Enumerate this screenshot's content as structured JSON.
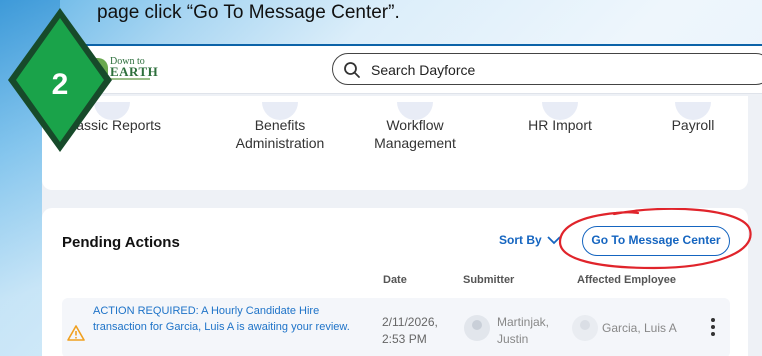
{
  "instruction": {
    "text": "page click “Go To Message Center”."
  },
  "step_badge": {
    "number": "2",
    "fill_color": "#1aa34a",
    "border_color": "#174a2a"
  },
  "header": {
    "logo_line1": "Down to",
    "logo_line2": "EARTH",
    "search_placeholder": "Search Dayforce",
    "accent_color": "#0c63a8"
  },
  "quick_access": {
    "items": [
      {
        "label_line1": "Classic Reports",
        "label_line2": ""
      },
      {
        "label_line1": "Benefits",
        "label_line2": "Administration"
      },
      {
        "label_line1": "Workflow",
        "label_line2": "Management"
      },
      {
        "label_line1": "HR Import",
        "label_line2": ""
      },
      {
        "label_line1": "Payroll",
        "label_line2": ""
      }
    ]
  },
  "pending_actions": {
    "title": "Pending Actions",
    "sort_label": "Sort By",
    "go_to_button": "Go To Message Center",
    "highlight_color": "#e0242b",
    "columns": {
      "date": "Date",
      "submitter": "Submitter",
      "affected": "Affected Employee"
    },
    "rows": [
      {
        "message": "ACTION REQUIRED: A Hourly Candidate Hire transaction for Garcia, Luis A is awaiting your review.",
        "date_line1": "2/11/2026,",
        "date_line2": "2:53 PM",
        "submitter_line1": "Martinjak,",
        "submitter_line2": "Justin",
        "affected_employee": "Garcia, Luis A"
      }
    ]
  }
}
